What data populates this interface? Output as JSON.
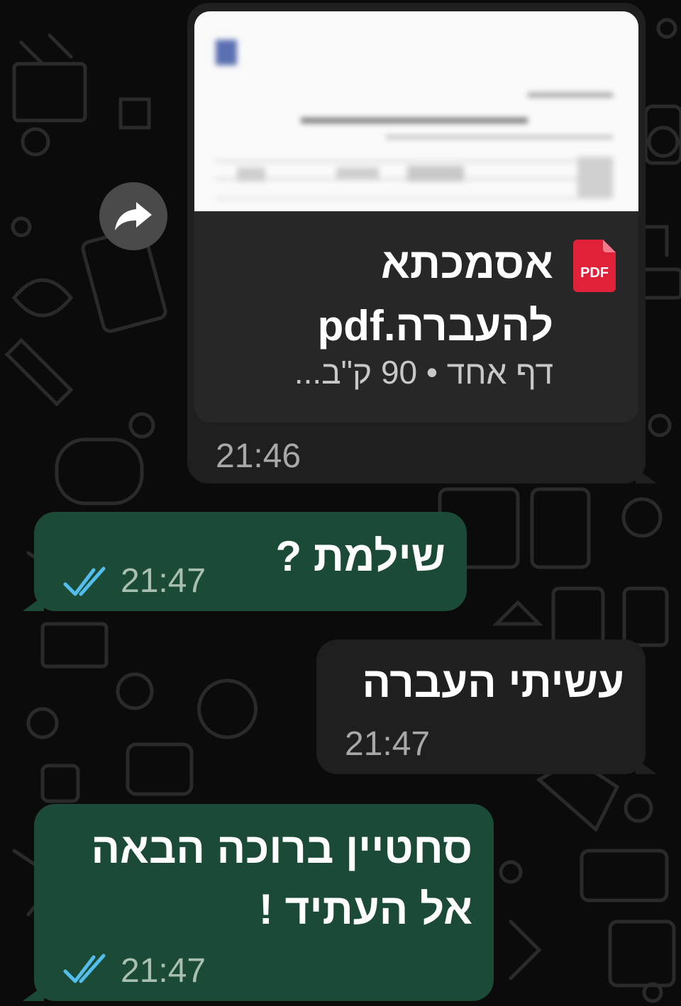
{
  "colors": {
    "background": "#0b0b0b",
    "incoming_bubble": "#1f1f1f",
    "outgoing_bubble": "#1b4a36",
    "read_ticks": "#53bdeb",
    "pdf_icon": "#e0213a"
  },
  "messages": [
    {
      "direction": "incoming",
      "type": "document",
      "file_name": "אסמכתא להעברה.pdf",
      "file_meta": "דף אחד • 90 ק\"ב...",
      "file_badge": "PDF",
      "time": "21:46",
      "forward_icon": "forward-arrow-icon"
    },
    {
      "direction": "outgoing",
      "type": "text",
      "text": "שילמת ?",
      "time": "21:47",
      "status": "read-double-check-icon"
    },
    {
      "direction": "incoming",
      "type": "text",
      "text": "עשיתי העברה",
      "time": "21:47"
    },
    {
      "direction": "outgoing",
      "type": "text",
      "text": "סחטיין ברוכה הבאה אל העתיד !",
      "time": "21:47",
      "status": "read-double-check-icon"
    }
  ]
}
